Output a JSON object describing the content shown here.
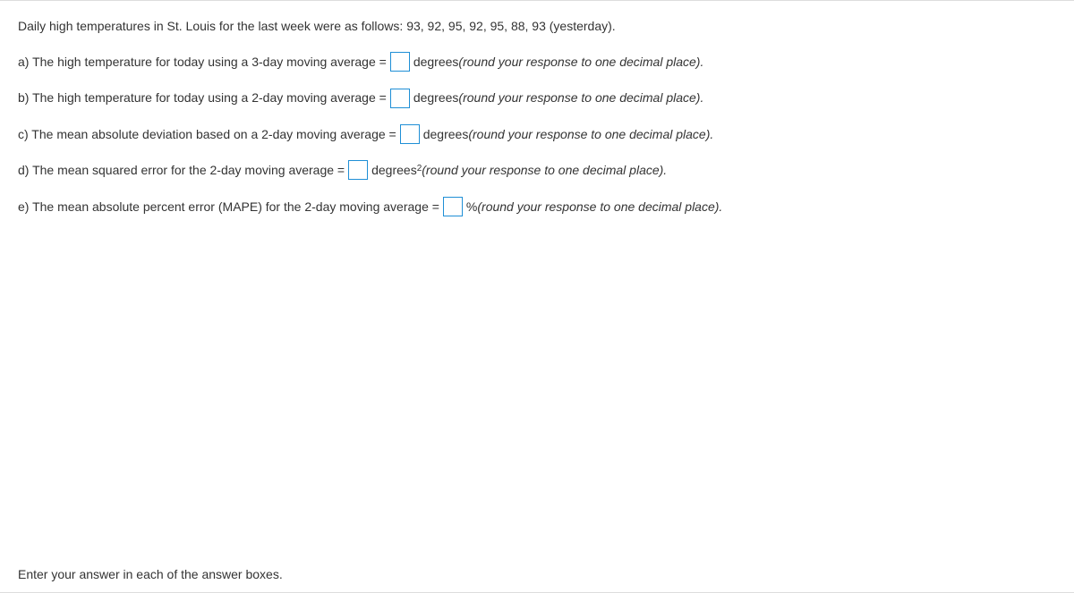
{
  "intro": "Daily high temperatures in St. Louis for the last week were as follows: 93, 92, 95, 92, 95, 88, 93 (yesterday).",
  "questions": {
    "a": {
      "prefix": "a) The high temperature for today using a 3-day moving average = ",
      "unit": " degrees ",
      "hint": "(round your response to one decimal place)."
    },
    "b": {
      "prefix": "b) The high temperature for today using a 2-day moving average = ",
      "unit": " degrees ",
      "hint": "(round your response to one decimal place)."
    },
    "c": {
      "prefix": "c) The mean absolute deviation based on a 2-day moving average = ",
      "unit": " degrees ",
      "hint": "(round your response to one decimal place)."
    },
    "d": {
      "prefix": "d) The mean squared error for the 2-day moving average = ",
      "unit_base": " degrees",
      "unit_sup": "2",
      "hint": " (round your response to one decimal place)."
    },
    "e": {
      "prefix": "e) The mean absolute percent error (MAPE) for the 2-day moving average = ",
      "unit": "% ",
      "hint": "(round your response to one decimal place)."
    }
  },
  "footer": "Enter your answer in each of the answer boxes."
}
